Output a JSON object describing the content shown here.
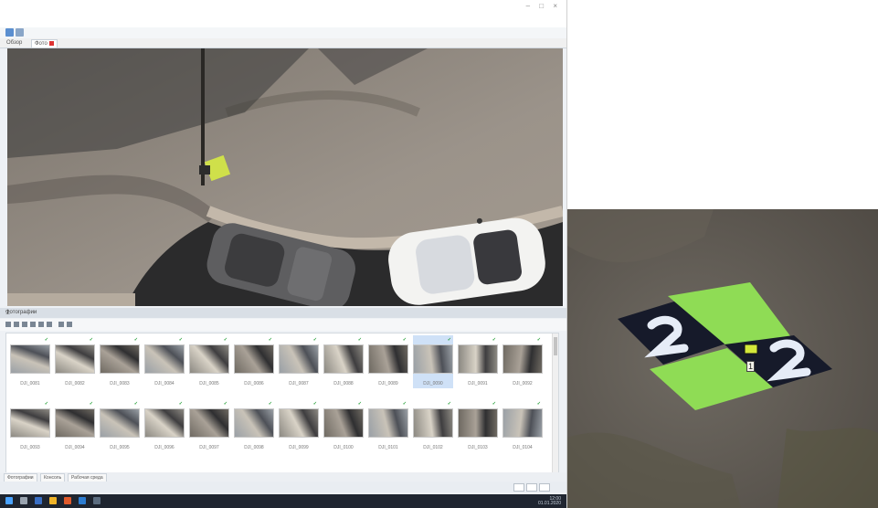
{
  "window": {
    "controls": [
      "–",
      "□",
      "×"
    ]
  },
  "tabs": [
    {
      "label": "Обзор"
    },
    {
      "label": "Фото"
    }
  ],
  "panel": {
    "title": "Фотографии",
    "pin": "⊥"
  },
  "thumbnails": {
    "row1": [
      {
        "caption": "DJI_0081",
        "badge": "✓"
      },
      {
        "caption": "DJI_0082",
        "badge": "✓"
      },
      {
        "caption": "DJI_0083",
        "badge": "✓"
      },
      {
        "caption": "DJI_0084",
        "badge": "✓"
      },
      {
        "caption": "DJI_0085",
        "badge": "✓"
      },
      {
        "caption": "DJI_0086",
        "badge": "✓"
      },
      {
        "caption": "DJI_0087",
        "badge": "✓"
      },
      {
        "caption": "DJI_0088",
        "badge": "✓"
      },
      {
        "caption": "DJI_0089",
        "badge": "✓"
      },
      {
        "caption": "DJI_0090",
        "badge": "✓",
        "selected": true
      },
      {
        "caption": "DJI_0091",
        "badge": "✓"
      },
      {
        "caption": "DJI_0092",
        "badge": "✓"
      }
    ],
    "row2": [
      {
        "caption": "DJI_0093",
        "badge": "✓"
      },
      {
        "caption": "DJI_0094",
        "badge": "✓"
      },
      {
        "caption": "DJI_0095",
        "badge": "✓"
      },
      {
        "caption": "DJI_0096",
        "badge": "✓"
      },
      {
        "caption": "DJI_0097",
        "badge": "✓"
      },
      {
        "caption": "DJI_0098",
        "badge": "✓"
      },
      {
        "caption": "DJI_0099",
        "badge": "✓"
      },
      {
        "caption": "DJI_0100",
        "badge": "✓"
      },
      {
        "caption": "DJI_0101",
        "badge": "✓"
      },
      {
        "caption": "DJI_0102",
        "badge": "✓"
      },
      {
        "caption": "DJI_0103",
        "badge": "✓"
      },
      {
        "caption": "DJI_0104",
        "badge": "✓"
      }
    ]
  },
  "bottom_tabs": [
    {
      "label": "Фотографии"
    },
    {
      "label": "Консоль"
    },
    {
      "label": "Рабочая среда"
    }
  ],
  "taskbar": {
    "clock": "12:00",
    "date": "01.01.2020"
  },
  "zoom": {
    "target_number": "2",
    "marker_label": "1"
  },
  "colors": {
    "accent": "#5b8fd0",
    "target_green": "#8fdc55",
    "selected": "#cfe1f7"
  }
}
